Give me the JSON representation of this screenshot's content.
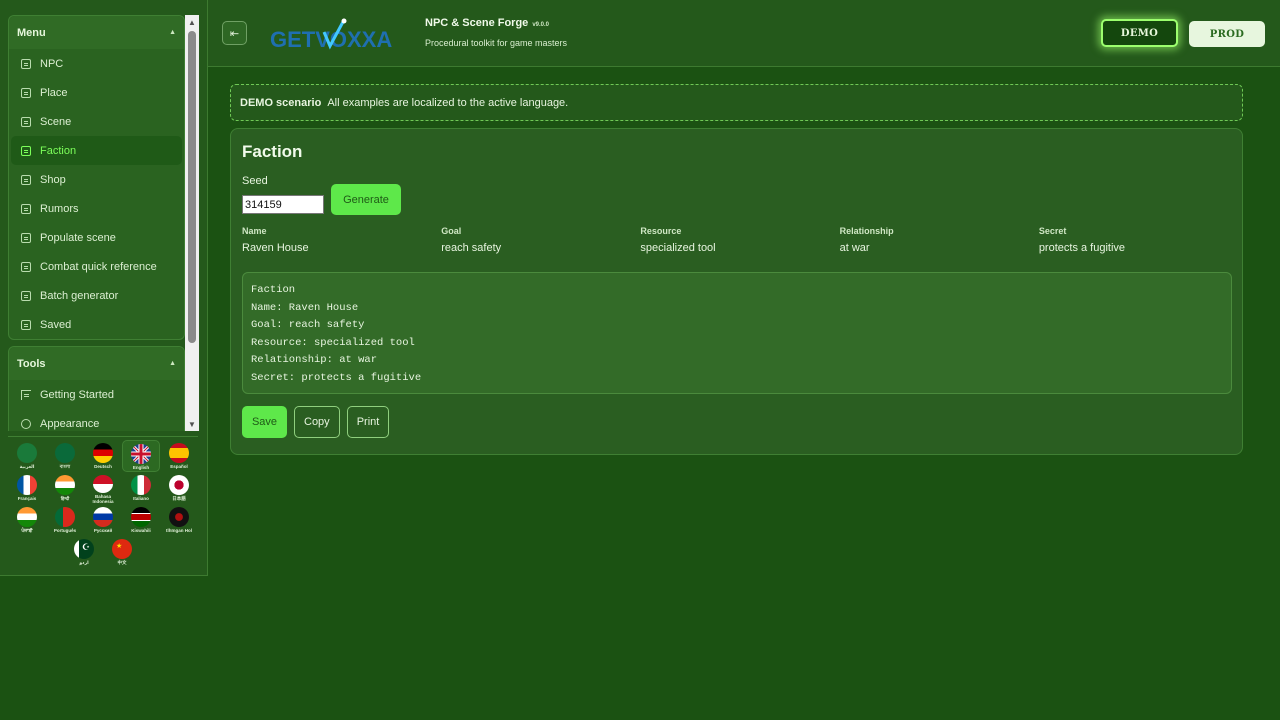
{
  "sidebar": {
    "menu": {
      "title": "Menu",
      "items": [
        {
          "label": "NPC"
        },
        {
          "label": "Place"
        },
        {
          "label": "Scene"
        },
        {
          "label": "Faction"
        },
        {
          "label": "Shop"
        },
        {
          "label": "Rumors"
        },
        {
          "label": "Populate scene"
        },
        {
          "label": "Combat quick reference"
        },
        {
          "label": "Batch generator"
        },
        {
          "label": "Saved"
        }
      ],
      "active_index": 3
    },
    "tools": {
      "title": "Tools",
      "items": [
        {
          "label": "Getting Started",
          "icon": "pointer-icon"
        },
        {
          "label": "Appearance",
          "icon": "palette-icon"
        }
      ]
    },
    "languages": [
      {
        "label": "العربية",
        "flag": "saudi-arabia"
      },
      {
        "label": "বাংলা",
        "flag": "bangladesh"
      },
      {
        "label": "Deutsch",
        "flag": "germany"
      },
      {
        "label": "English",
        "flag": "united-kingdom",
        "active": true
      },
      {
        "label": "Español",
        "flag": "spain"
      },
      {
        "label": "Français",
        "flag": "france"
      },
      {
        "label": "हिन्दी",
        "flag": "india"
      },
      {
        "label": "Bahasa Indonesia",
        "flag": "indonesia"
      },
      {
        "label": "Italiano",
        "flag": "italy"
      },
      {
        "label": "日本語",
        "flag": "japan"
      },
      {
        "label": "ਪੰਜਾਬੀ",
        "flag": "india"
      },
      {
        "label": "Português",
        "flag": "portugal"
      },
      {
        "label": "Русский",
        "flag": "russia"
      },
      {
        "label": "Kiswahili",
        "flag": "kenya"
      },
      {
        "label": "tlhIngan Hol",
        "flag": "klingon"
      },
      {
        "label": "اردو",
        "flag": "pakistan"
      },
      {
        "label": "中文",
        "flag": "china"
      }
    ]
  },
  "header": {
    "logo_text": "GETVOXXA",
    "app_title": "NPC & Scene Forge",
    "version": "v9.0.0",
    "subtitle": "Procedural toolkit for game masters",
    "demo_label": "DEMO",
    "prod_label": "PROD"
  },
  "banner": {
    "strong": "DEMO scenario",
    "text": "All examples are localized to the active language."
  },
  "card": {
    "title": "Faction",
    "seed_label": "Seed",
    "seed_value": "314159",
    "generate_label": "Generate",
    "fields": [
      {
        "label": "Name",
        "value": "Raven House"
      },
      {
        "label": "Goal",
        "value": "reach safety"
      },
      {
        "label": "Resource",
        "value": "specialized tool"
      },
      {
        "label": "Relationship",
        "value": "at war"
      },
      {
        "label": "Secret",
        "value": "protects a fugitive"
      }
    ],
    "output_lines": [
      "Faction",
      "Name: Raven House",
      "Goal: reach safety",
      "Resource: specialized tool",
      "Relationship: at war",
      "Secret: protects a fugitive"
    ],
    "save_label": "Save",
    "copy_label": "Copy",
    "print_label": "Print"
  },
  "colors": {
    "background": "#1b5212",
    "accent": "#5ee84a",
    "active_text": "#7cff5a"
  }
}
